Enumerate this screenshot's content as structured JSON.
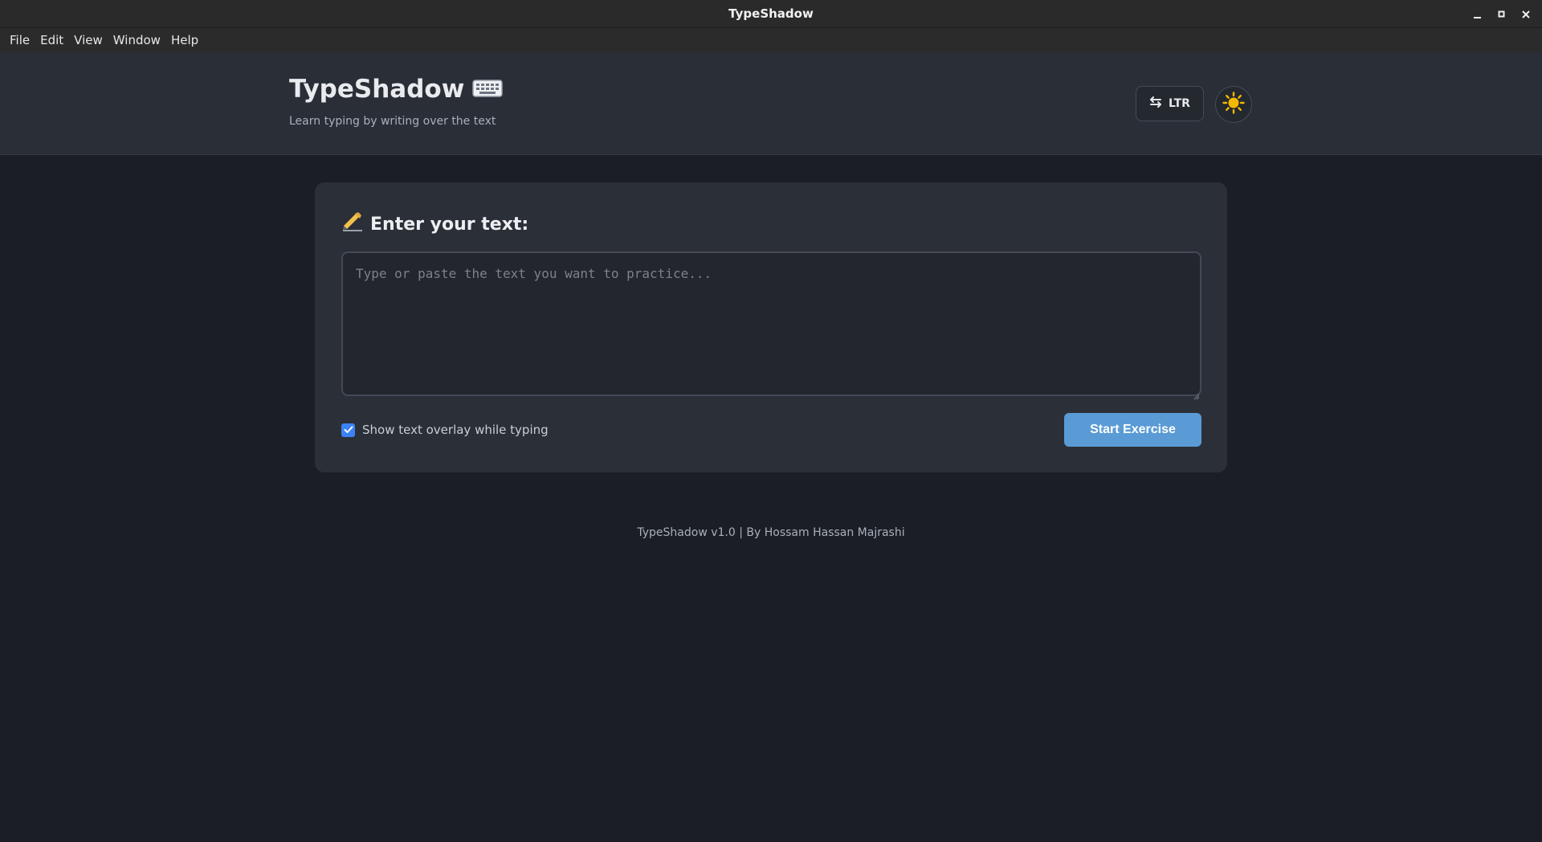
{
  "window": {
    "title": "TypeShadow",
    "controls": [
      "minimize-icon",
      "maximize-icon",
      "close-icon"
    ]
  },
  "menubar": {
    "items": [
      {
        "label": "File"
      },
      {
        "label": "Edit"
      },
      {
        "label": "View"
      },
      {
        "label": "Window"
      },
      {
        "label": "Help"
      }
    ]
  },
  "header": {
    "title": "TypeShadow",
    "title_icon": "keyboard-icon",
    "subtitle": "Learn typing by writing over the text",
    "direction_button": {
      "label": "LTR",
      "icon": "swap-arrows-icon"
    },
    "theme_button": {
      "icon": "sun-icon"
    }
  },
  "editor": {
    "title_icon": "writing-hand-icon",
    "title": "Enter your text:",
    "textarea": {
      "value": "",
      "placeholder": "Type or paste the text you want to practice..."
    },
    "overlay_option": {
      "label": "Show text overlay while typing",
      "checked": true
    },
    "start_button": {
      "label": "Start Exercise"
    }
  },
  "footer": {
    "text": "TypeShadow v1.0 | By Hossam Hassan Majrashi"
  },
  "colors": {
    "background": "#1b1e25",
    "header": "#2a2e36",
    "card": "#2b2f37",
    "accent": "#5a9bd5",
    "checkbox": "#3b82f6",
    "sun": "#f5b800"
  }
}
